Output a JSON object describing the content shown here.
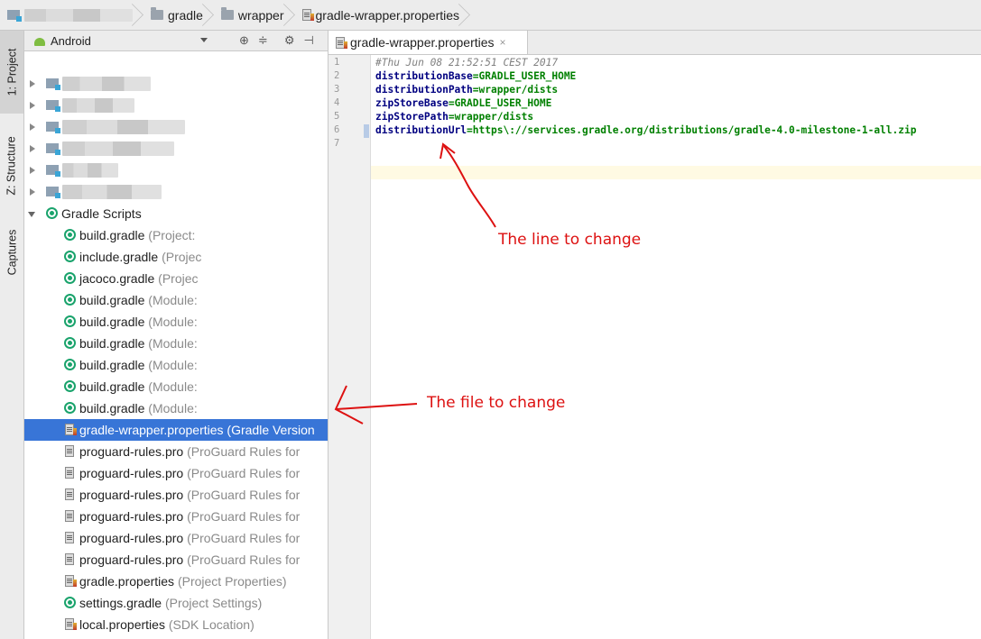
{
  "breadcrumb": {
    "items": [
      "gradle",
      "wrapper",
      "gradle-wrapper.properties"
    ]
  },
  "side_tabs": {
    "project": "1: Project",
    "structure": "Z: Structure",
    "captures": "Captures"
  },
  "project_panel": {
    "view_mode": "Android",
    "group_label": "Gradle Scripts",
    "files": [
      {
        "name": "build.gradle",
        "hint": "(Project:",
        "icon": "gradle-icon"
      },
      {
        "name": "include.gradle",
        "hint": "(Projec",
        "icon": "gradle-icon"
      },
      {
        "name": "jacoco.gradle",
        "hint": "(Projec",
        "icon": "gradle-icon"
      },
      {
        "name": "build.gradle",
        "hint": "(Module:",
        "icon": "gradle-icon"
      },
      {
        "name": "build.gradle",
        "hint": "(Module:",
        "icon": "gradle-icon"
      },
      {
        "name": "build.gradle",
        "hint": "(Module:",
        "icon": "gradle-icon"
      },
      {
        "name": "build.gradle",
        "hint": "(Module:",
        "icon": "gradle-icon"
      },
      {
        "name": "build.gradle",
        "hint": "(Module:",
        "icon": "gradle-icon"
      },
      {
        "name": "build.gradle",
        "hint": "(Module:",
        "icon": "gradle-icon"
      },
      {
        "name": "gradle-wrapper.properties",
        "hint": "(Gradle Version",
        "icon": "properties-icon",
        "selected": true
      },
      {
        "name": "proguard-rules.pro",
        "hint": "(ProGuard Rules for",
        "icon": "text-file-icon"
      },
      {
        "name": "proguard-rules.pro",
        "hint": "(ProGuard Rules for",
        "icon": "text-file-icon"
      },
      {
        "name": "proguard-rules.pro",
        "hint": "(ProGuard Rules for",
        "icon": "text-file-icon"
      },
      {
        "name": "proguard-rules.pro",
        "hint": "(ProGuard Rules for",
        "icon": "text-file-icon"
      },
      {
        "name": "proguard-rules.pro",
        "hint": "(ProGuard Rules for",
        "icon": "text-file-icon"
      },
      {
        "name": "proguard-rules.pro",
        "hint": "(ProGuard Rules for",
        "icon": "text-file-icon"
      },
      {
        "name": "gradle.properties",
        "hint": "(Project Properties)",
        "icon": "properties-icon"
      },
      {
        "name": "settings.gradle",
        "hint": "(Project Settings)",
        "icon": "gradle-icon"
      },
      {
        "name": "local.properties",
        "hint": "(SDK Location)",
        "icon": "properties-icon"
      }
    ]
  },
  "editor": {
    "tab_label": "gradle-wrapper.properties",
    "tab_close": "×",
    "line_numbers": [
      "1",
      "2",
      "3",
      "4",
      "5",
      "6",
      "7"
    ],
    "lines": [
      {
        "comment": "#Thu Jun 08 21:52:51 CEST 2017"
      },
      {
        "key": "distributionBase",
        "value": "=GRADLE_USER_HOME"
      },
      {
        "key": "distributionPath",
        "value": "=wrapper/dists"
      },
      {
        "key": "zipStoreBase",
        "value": "=GRADLE_USER_HOME"
      },
      {
        "key": "zipStorePath",
        "value": "=wrapper/dists"
      },
      {
        "key": "distributionUrl",
        "value": "=https\\://services.gradle.org/distributions/gradle-4.0-milestone-1-all.zip"
      }
    ]
  },
  "annotations": {
    "line_note": "The line to change",
    "file_note": "The file to change",
    "color": "#dd1111"
  }
}
